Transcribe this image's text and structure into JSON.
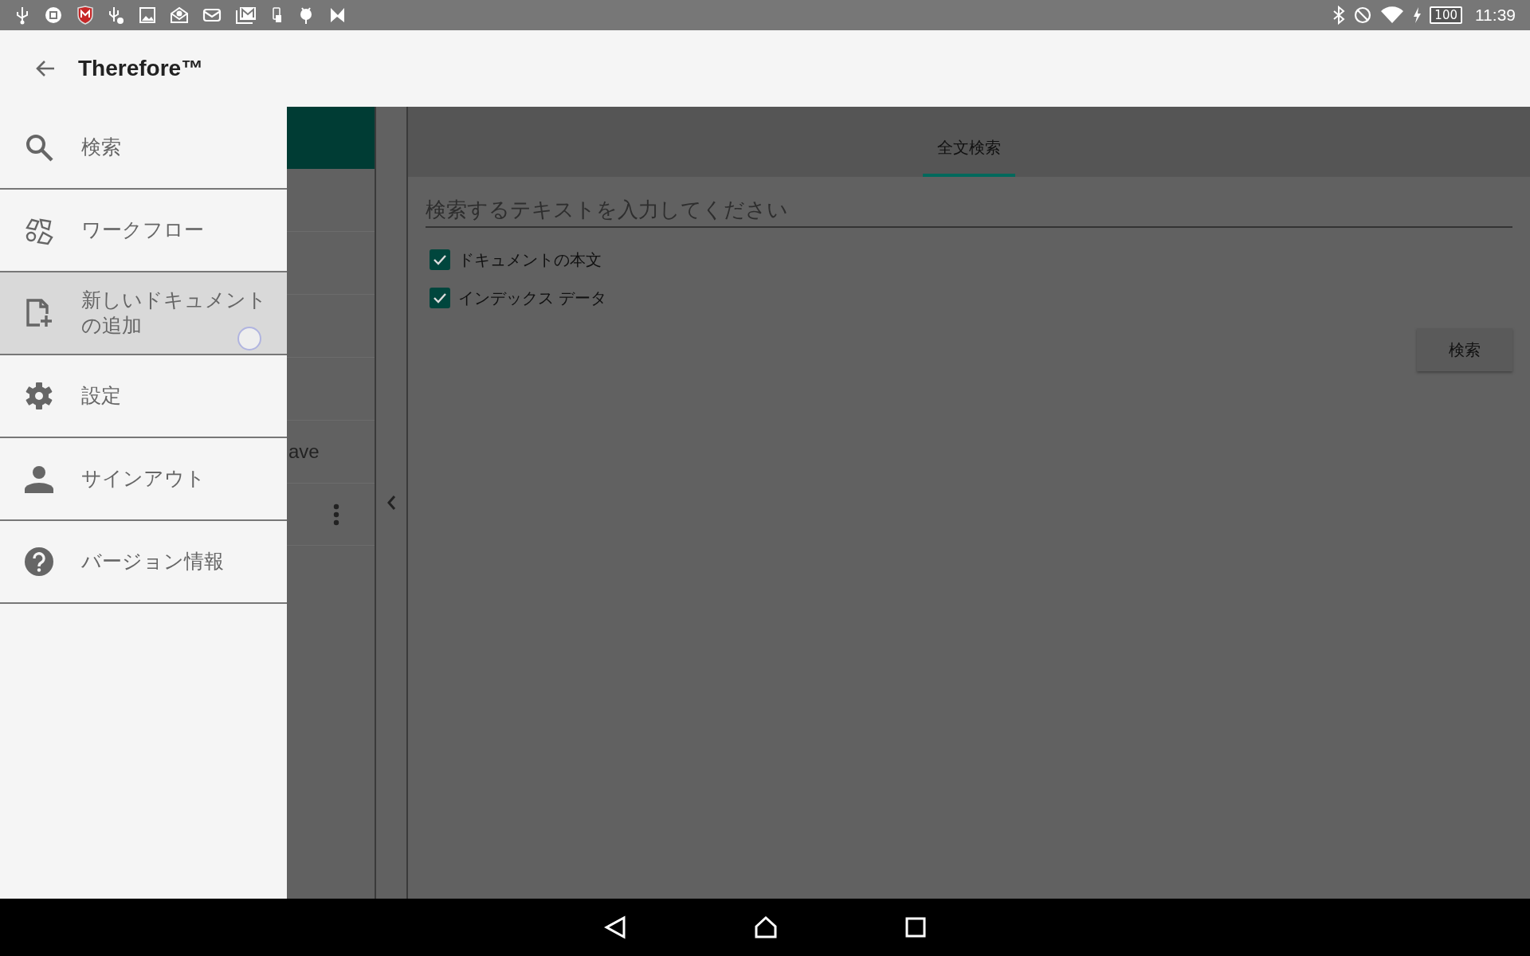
{
  "status_bar": {
    "battery": "100",
    "time": "11:39"
  },
  "app_bar": {
    "title": "Therefore™"
  },
  "drawer": {
    "items": [
      {
        "label": "検索",
        "selected": false
      },
      {
        "label": "ワークフロー",
        "selected": false
      },
      {
        "label": "新しいドキュメントの追加",
        "selected": true
      },
      {
        "label": "設定",
        "selected": false
      },
      {
        "label": "サインアウト",
        "selected": false
      },
      {
        "label": "バージョン情報",
        "selected": false
      }
    ]
  },
  "list_panel": {
    "partial_text": "ave"
  },
  "search_panel": {
    "tabs": [
      {
        "label": "全文検索",
        "selected": true
      }
    ],
    "search_field": {
      "placeholder": "検索するテキストを入力してください"
    },
    "options": [
      {
        "label": "ドキュメントの本文",
        "checked": true
      },
      {
        "label": "インデックス データ",
        "checked": true
      }
    ],
    "button": "検索"
  }
}
